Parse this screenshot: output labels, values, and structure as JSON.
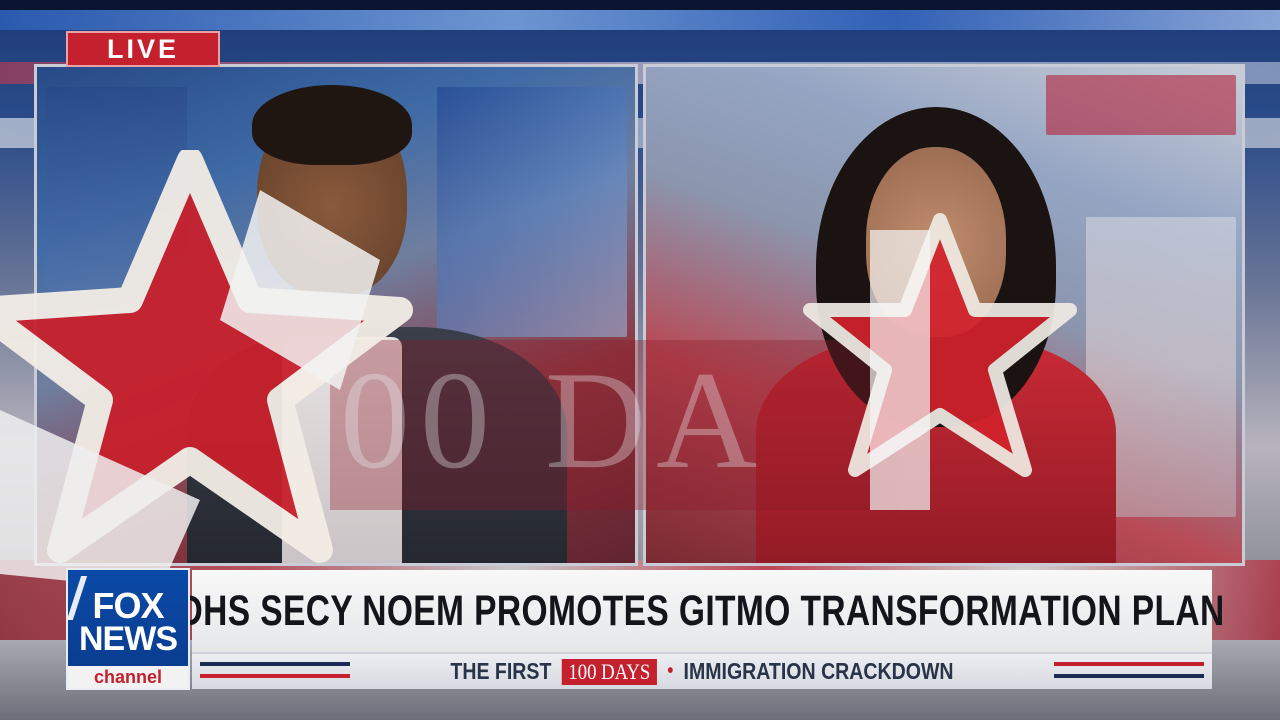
{
  "live_badge": "LIVE",
  "headline": "DHS SECY NOEM PROMOTES GITMO TRANSFORMATION PLAN",
  "subline": {
    "left": "THE FIRST",
    "badge": "100 DAYS",
    "separator": "•",
    "right": "IMMIGRATION CRACKDOWN"
  },
  "logo": {
    "line1": "FOX",
    "line2": "NEWS",
    "line3": "channel"
  },
  "watermark_text": "00 DA",
  "colors": {
    "brand_red": "#c5202d",
    "brand_blue": "#0b4aa8",
    "headline_bg": "#f2f2f2"
  }
}
